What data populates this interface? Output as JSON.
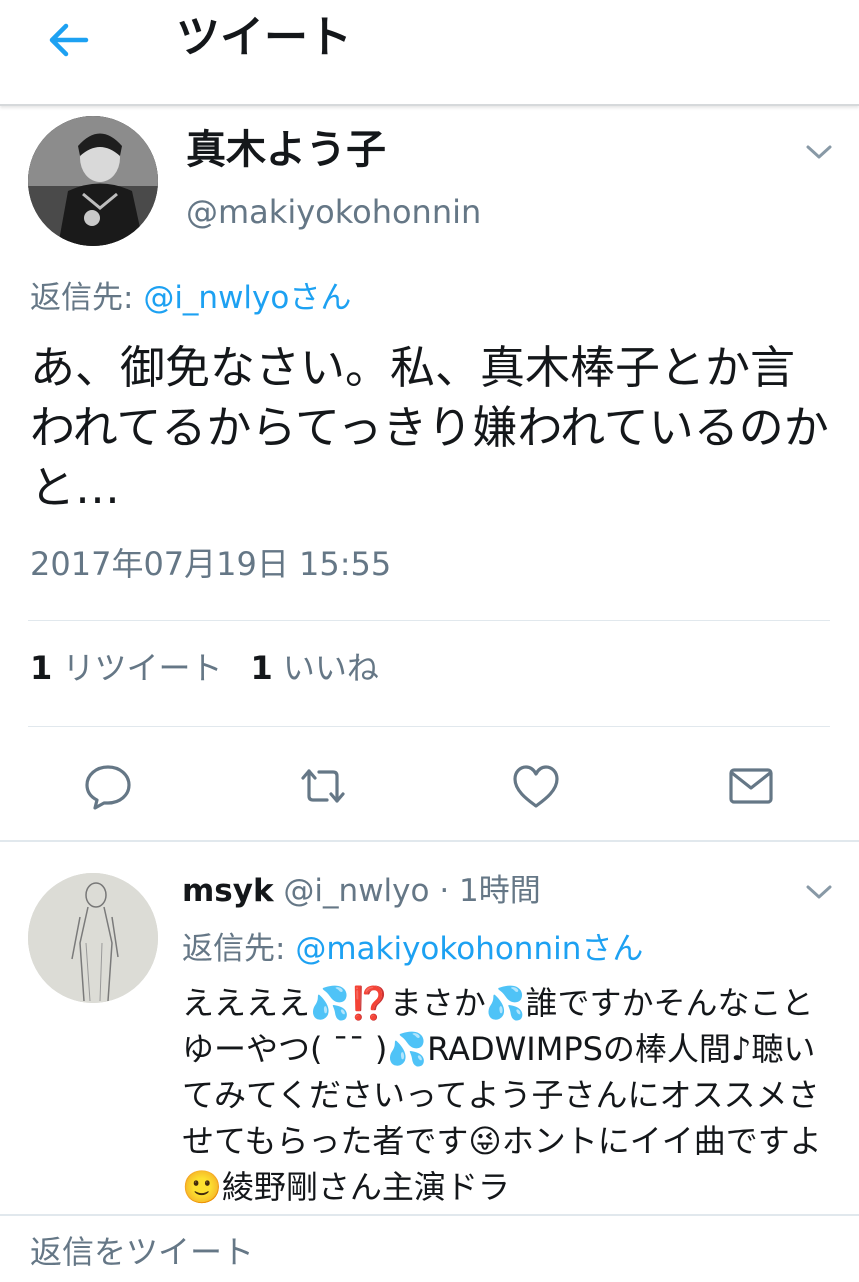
{
  "header": {
    "title": "ツイート"
  },
  "tweet": {
    "display_name": "真木よう子",
    "handle": "@makiyokohonnin",
    "reply_prefix": "返信先: ",
    "reply_mention": "@i_nwlyoさん",
    "text": "あ、御免なさい。私、真木棒子とか言われてるからてっきり嫌われているのかと…",
    "timestamp": "2017年07月19日 15:55",
    "retweet_count": "1",
    "retweet_label": "リツイート",
    "like_count": "1",
    "like_label": "いいね"
  },
  "actions": [
    "reply-icon",
    "retweet-icon",
    "like-icon",
    "dm-icon"
  ],
  "reply": {
    "display_name": "msyk",
    "meta": " @i_nwlyo · 1時間",
    "reply_prefix": "返信先: ",
    "reply_mention": "@makiyokohonninさん",
    "text": "ええええ💦⁉️まさか💦誰ですかそんなことゆーやつ( ¯¯ )💦RADWIMPSの棒人間♪聴いてみてくださいってよう子さんにオススメさせてもらった者です😜ホントにイイ曲ですよ🙂綾野剛さん主演ドラ"
  },
  "composer": {
    "placeholder": "返信をツイート"
  },
  "colors": {
    "accent": "#1da1f2",
    "secondary_text": "#657786",
    "primary_text": "#14171a",
    "divider": "#e1e8ed"
  }
}
